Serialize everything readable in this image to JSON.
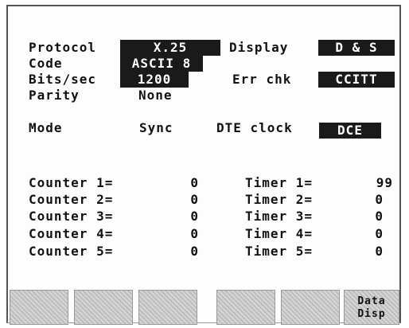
{
  "settings": {
    "protocol": {
      "label": "Protocol",
      "value": "X.25"
    },
    "code": {
      "label": "Code",
      "value": "ASCII 8"
    },
    "bits_sec": {
      "label": "Bits/sec",
      "value": "1200"
    },
    "parity": {
      "label": "Parity",
      "value": "None"
    },
    "mode": {
      "label": "Mode",
      "value": "Sync"
    },
    "display": {
      "label": "Display",
      "value": "D & S"
    },
    "err_chk": {
      "label": "Err chk",
      "value": "CCITT"
    },
    "dte_clock": {
      "label": "DTE clock",
      "value": "DCE"
    }
  },
  "counters": [
    {
      "label": "Counter 1=",
      "value": "0"
    },
    {
      "label": "Counter 2=",
      "value": "0"
    },
    {
      "label": "Counter 3=",
      "value": "0"
    },
    {
      "label": "Counter 4=",
      "value": "0"
    },
    {
      "label": "Counter 5=",
      "value": "0"
    }
  ],
  "timers": [
    {
      "label": "Timer 1=",
      "value": "99"
    },
    {
      "label": "Timer 2=",
      "value": "0"
    },
    {
      "label": "Timer 3=",
      "value": "0"
    },
    {
      "label": "Timer 4=",
      "value": "0"
    },
    {
      "label": "Timer 5=",
      "value": "0"
    }
  ],
  "softkeys": [
    {
      "line1": "",
      "line2": ""
    },
    {
      "line1": "",
      "line2": ""
    },
    {
      "line1": "",
      "line2": ""
    },
    {
      "line1": "",
      "line2": ""
    },
    {
      "line1": "",
      "line2": ""
    },
    {
      "line1": "Data",
      "line2": "Disp"
    }
  ]
}
